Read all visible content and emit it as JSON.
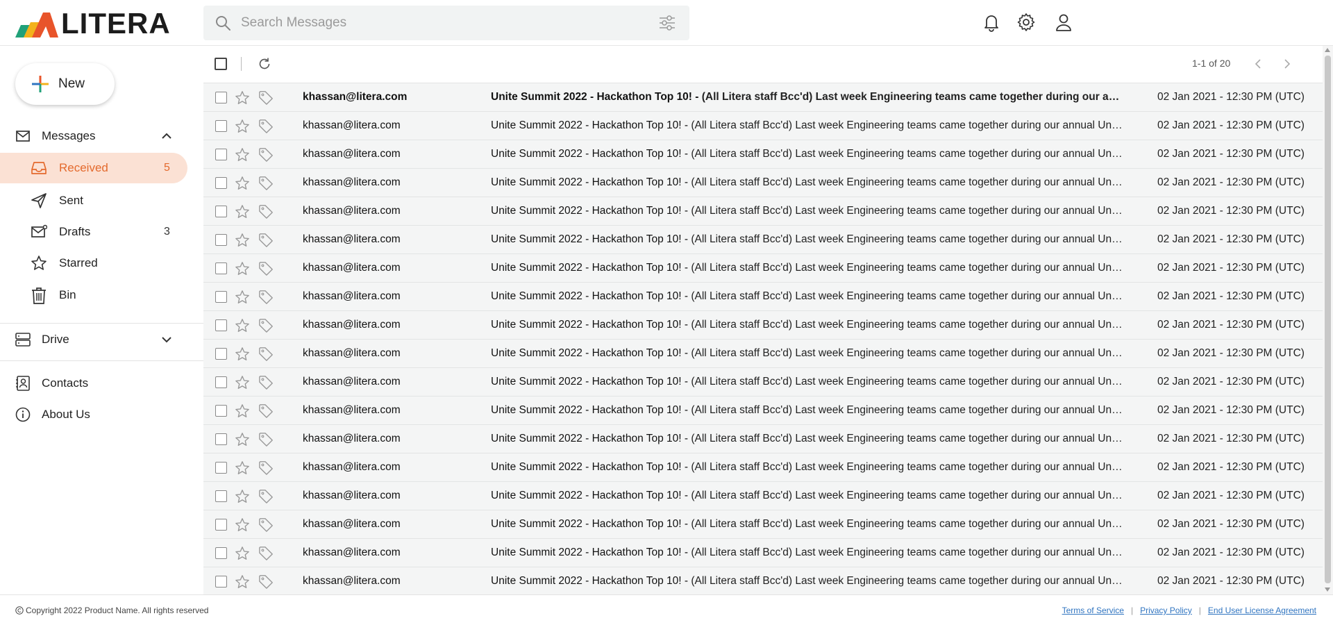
{
  "brand": {
    "name": "LITERA"
  },
  "search": {
    "placeholder": "Search Messages"
  },
  "sidebar": {
    "new_label": "New",
    "messages_label": "Messages",
    "items": [
      {
        "label": "Received",
        "count": "5"
      },
      {
        "label": "Sent",
        "count": ""
      },
      {
        "label": "Drafts",
        "count": "3"
      },
      {
        "label": "Starred",
        "count": ""
      },
      {
        "label": "Bin",
        "count": ""
      }
    ],
    "drive_label": "Drive",
    "contacts_label": "Contacts",
    "about_label": "About Us"
  },
  "toolbar": {
    "pager": "1-1 of 20"
  },
  "messages": [
    {
      "sender": "khassan@litera.com",
      "subject": "Unite Summit 2022 - Hackathon Top 10! - ",
      "preview": "(All Litera staff Bcc'd) Last week Engineering teams came together during our annual Unite to celebrate the most innovative ideas",
      "date": "02 Jan 2021 - 12:30 PM (UTC)",
      "unread": true
    },
    {
      "sender": "khassan@litera.com",
      "subject": "Unite Summit 2022 - Hackathon Top 10!  - ",
      "preview": "(All Litera staff Bcc'd) Last week Engineering teams came together during our annual Unite to celebrate the most innovative ideas",
      "date": "02 Jan 2021 - 12:30 PM (UTC)",
      "unread": false
    },
    {
      "sender": "khassan@litera.com",
      "subject": "Unite Summit 2022 - Hackathon Top 10!  - ",
      "preview": "(All Litera staff Bcc'd) Last week Engineering teams came together during our annual Unite to celebrate the most innovative ideas",
      "date": "02 Jan 2021 - 12:30 PM (UTC)",
      "unread": false
    },
    {
      "sender": "khassan@litera.com",
      "subject": "Unite Summit 2022 - Hackathon Top 10!  - ",
      "preview": "(All Litera staff Bcc'd) Last week Engineering teams came together during our annual Unite to celebrate the most innovative ideas",
      "date": "02 Jan 2021 - 12:30 PM (UTC)",
      "unread": false
    },
    {
      "sender": "khassan@litera.com",
      "subject": "Unite Summit 2022 - Hackathon Top 10!  - ",
      "preview": "(All Litera staff Bcc'd) Last week Engineering teams came together during our annual Unite to celebrate the most innovative ideas",
      "date": "02 Jan 2021 - 12:30 PM (UTC)",
      "unread": false
    },
    {
      "sender": "khassan@litera.com",
      "subject": "Unite Summit 2022 - Hackathon Top 10!  - ",
      "preview": "(All Litera staff Bcc'd) Last week Engineering teams came together during our annual Unite to celebrate the most innovative ideas",
      "date": "02 Jan 2021 - 12:30 PM (UTC)",
      "unread": false
    },
    {
      "sender": "khassan@litera.com",
      "subject": "Unite Summit 2022 - Hackathon Top 10!  - ",
      "preview": "(All Litera staff Bcc'd) Last week Engineering teams came together during our annual Unite to celebrate the most innovative ideas",
      "date": "02 Jan 2021 - 12:30 PM (UTC)",
      "unread": false
    },
    {
      "sender": "khassan@litera.com",
      "subject": "Unite Summit 2022 - Hackathon Top 10!  - ",
      "preview": "(All Litera staff Bcc'd) Last week Engineering teams came together during our annual Unite to celebrate the most innovative ideas",
      "date": "02 Jan 2021 - 12:30 PM (UTC)",
      "unread": false
    },
    {
      "sender": "khassan@litera.com",
      "subject": "Unite Summit 2022 - Hackathon Top 10!  - ",
      "preview": "(All Litera staff Bcc'd) Last week Engineering teams came together during our annual Unite to celebrate the most innovative ideas",
      "date": "02 Jan 2021 - 12:30 PM (UTC)",
      "unread": false
    },
    {
      "sender": "khassan@litera.com",
      "subject": "Unite Summit 2022 - Hackathon Top 10!  - ",
      "preview": "(All Litera staff Bcc'd) Last week Engineering teams came together during our annual Unite to celebrate the most innovative ideas",
      "date": "02 Jan 2021 - 12:30 PM (UTC)",
      "unread": false
    },
    {
      "sender": "khassan@litera.com",
      "subject": "Unite Summit 2022 - Hackathon Top 10!  - ",
      "preview": "(All Litera staff Bcc'd) Last week Engineering teams came together during our annual Unite to celebrate the most innovative ideas",
      "date": "02 Jan 2021 - 12:30 PM (UTC)",
      "unread": false
    },
    {
      "sender": "khassan@litera.com",
      "subject": "Unite Summit 2022 - Hackathon Top 10!  - ",
      "preview": "(All Litera staff Bcc'd) Last week Engineering teams came together during our annual Unite to celebrate the most innovative ideas",
      "date": "02 Jan 2021 - 12:30 PM (UTC)",
      "unread": false
    },
    {
      "sender": "khassan@litera.com",
      "subject": "Unite Summit 2022 - Hackathon Top 10!  - ",
      "preview": "(All Litera staff Bcc'd) Last week Engineering teams came together during our annual Unite to celebrate the most innovative ideas",
      "date": "02 Jan 2021 - 12:30 PM (UTC)",
      "unread": false
    },
    {
      "sender": "khassan@litera.com",
      "subject": "Unite Summit 2022 - Hackathon Top 10!  - ",
      "preview": "(All Litera staff Bcc'd) Last week Engineering teams came together during our annual Unite to celebrate the most innovative ideas",
      "date": "02 Jan 2021 - 12:30 PM (UTC)",
      "unread": false
    },
    {
      "sender": "khassan@litera.com",
      "subject": "Unite Summit 2022 - Hackathon Top 10!  - ",
      "preview": "(All Litera staff Bcc'd) Last week Engineering teams came together during our annual Unite to celebrate the most innovative ideas",
      "date": "02 Jan 2021 - 12:30 PM (UTC)",
      "unread": false
    },
    {
      "sender": "khassan@litera.com",
      "subject": "Unite Summit 2022 - Hackathon Top 10!  - ",
      "preview": "(All Litera staff Bcc'd) Last week Engineering teams came together during our annual Unite to celebrate the most innovative ideas",
      "date": "02 Jan 2021 - 12:30 PM (UTC)",
      "unread": false
    },
    {
      "sender": "khassan@litera.com",
      "subject": "Unite Summit 2022 - Hackathon Top 10!  - ",
      "preview": "(All Litera staff Bcc'd) Last week Engineering teams came together during our annual Unite to celebrate the most innovative ideas",
      "date": "02 Jan 2021 - 12:30 PM (UTC)",
      "unread": false
    },
    {
      "sender": "khassan@litera.com",
      "subject": "Unite Summit 2022 - Hackathon Top 10!  - ",
      "preview": "(All Litera staff Bcc'd) Last week Engineering teams came together during our annual Unite to celebrate the most innovative ideas",
      "date": "02 Jan 2021 - 12:30 PM (UTC)",
      "unread": false
    }
  ],
  "footer": {
    "copyright": "Copyright 2022 Product Name. All rights reserved",
    "links": [
      "Terms of Service",
      "Privacy Policy",
      "End User License Agreement"
    ]
  },
  "colors": {
    "accent": "#e46a2d",
    "active_bg": "#fbe1d4",
    "row_bg": "#f4f5f5",
    "link": "#2f74c0"
  }
}
